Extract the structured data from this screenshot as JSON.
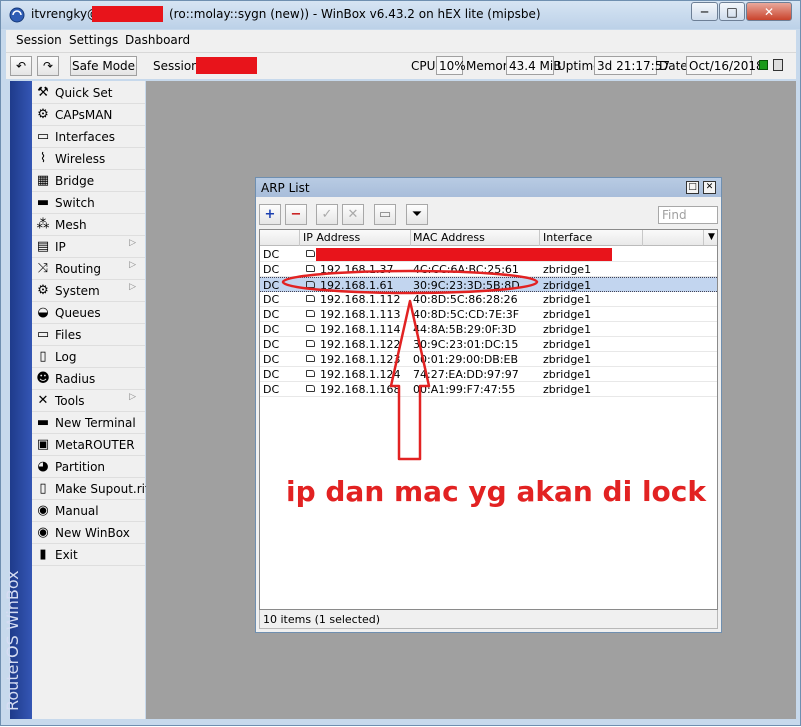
{
  "window": {
    "title_user": "itvrengky@",
    "title_rest": "(ro::molay::sygn (new)) - WinBox v6.43.2 on hEX lite (mipsbe)",
    "min_glyph": "─",
    "max_glyph": "□",
    "close_glyph": "✕"
  },
  "menu": [
    "Session",
    "Settings",
    "Dashboard"
  ],
  "toolbar": {
    "undo_glyph": "↶",
    "redo_glyph": "↷",
    "safe_mode_label": "Safe Mode",
    "session_label": "Session:",
    "cpu_label": "CPU:",
    "cpu_value": "10%",
    "memory_label": "Memory:",
    "memory_value": "43.4 MiB",
    "uptime_label": "Uptime:",
    "uptime_value": "3d 21:17:57",
    "date_label": "Date:",
    "date_value": "Oct/16/2018"
  },
  "brand": "RouterOS WinBox",
  "sidebar": {
    "items": [
      {
        "label": "Quick Set",
        "icon": "quick-set-icon",
        "glyph": "⚒"
      },
      {
        "label": "CAPsMAN",
        "icon": "capsman-icon",
        "glyph": "⚙"
      },
      {
        "label": "Interfaces",
        "icon": "interfaces-icon",
        "glyph": "▭"
      },
      {
        "label": "Wireless",
        "icon": "wireless-icon",
        "glyph": "⌇"
      },
      {
        "label": "Bridge",
        "icon": "bridge-icon",
        "glyph": "▦"
      },
      {
        "label": "Switch",
        "icon": "switch-icon",
        "glyph": "▬"
      },
      {
        "label": "Mesh",
        "icon": "mesh-icon",
        "glyph": "⁂"
      },
      {
        "label": "IP",
        "icon": "ip-icon",
        "glyph": "▤",
        "submenu": true
      },
      {
        "label": "Routing",
        "icon": "routing-icon",
        "glyph": "⤨",
        "submenu": true
      },
      {
        "label": "System",
        "icon": "system-icon",
        "glyph": "⚙",
        "submenu": true
      },
      {
        "label": "Queues",
        "icon": "queues-icon",
        "glyph": "◒"
      },
      {
        "label": "Files",
        "icon": "files-icon",
        "glyph": "▭"
      },
      {
        "label": "Log",
        "icon": "log-icon",
        "glyph": "▯"
      },
      {
        "label": "Radius",
        "icon": "radius-icon",
        "glyph": "☻"
      },
      {
        "label": "Tools",
        "icon": "tools-icon",
        "glyph": "✕",
        "submenu": true
      },
      {
        "label": "New Terminal",
        "icon": "terminal-icon",
        "glyph": "▬"
      },
      {
        "label": "MetaROUTER",
        "icon": "metarouter-icon",
        "glyph": "▣"
      },
      {
        "label": "Partition",
        "icon": "partition-icon",
        "glyph": "◕"
      },
      {
        "label": "Make Supout.rif",
        "icon": "supout-icon",
        "glyph": "▯"
      },
      {
        "label": "Manual",
        "icon": "manual-icon",
        "glyph": "◉"
      },
      {
        "label": "New WinBox",
        "icon": "new-winbox-icon",
        "glyph": "◉"
      },
      {
        "label": "Exit",
        "icon": "exit-icon",
        "glyph": "▮"
      }
    ],
    "submenu_arrow": "▷"
  },
  "arp": {
    "title": "ARP List",
    "find_placeholder": "Find",
    "add_glyph": "+",
    "remove_glyph": "−",
    "enable_glyph": "✓",
    "disable_glyph": "✕",
    "comment_glyph": "▭",
    "filter_glyph": "⏷",
    "columns": [
      "",
      "IP Address",
      "MAC Address",
      "Interface"
    ],
    "header_arrow": "▼",
    "rows": [
      {
        "flag": "DC",
        "ip": "",
        "mac": "",
        "iface": "",
        "redacted": true
      },
      {
        "flag": "DC",
        "ip": "192.168.1.37",
        "mac": "4C:CC:6A:BC:25:61",
        "iface": "zbridge1"
      },
      {
        "flag": "DC",
        "ip": "192.168.1.61",
        "mac": "30:9C:23:3D:5B:8D",
        "iface": "zbridge1",
        "selected": true
      },
      {
        "flag": "DC",
        "ip": "192.168.1.112",
        "mac": "40:8D:5C:86:28:26",
        "iface": "zbridge1"
      },
      {
        "flag": "DC",
        "ip": "192.168.1.113",
        "mac": "40:8D:5C:CD:7E:3F",
        "iface": "zbridge1"
      },
      {
        "flag": "DC",
        "ip": "192.168.1.114",
        "mac": "44:8A:5B:29:0F:3D",
        "iface": "zbridge1"
      },
      {
        "flag": "DC",
        "ip": "192.168.1.122",
        "mac": "30:9C:23:01:DC:15",
        "iface": "zbridge1"
      },
      {
        "flag": "DC",
        "ip": "192.168.1.123",
        "mac": "00:01:29:00:DB:EB",
        "iface": "zbridge1"
      },
      {
        "flag": "DC",
        "ip": "192.168.1.124",
        "mac": "74:27:EA:DD:97:97",
        "iface": "zbridge1"
      },
      {
        "flag": "DC",
        "ip": "192.168.1.168",
        "mac": "00:A1:99:F7:47:55",
        "iface": "zbridge1"
      }
    ],
    "status": "10 items (1 selected)"
  },
  "annotation": "ip dan mac yg akan di lock",
  "colors": {
    "annotation": "#e22222",
    "redaction": "#e8141b",
    "selection": "#c2d5ef",
    "workspace": "#a0a0a0"
  }
}
